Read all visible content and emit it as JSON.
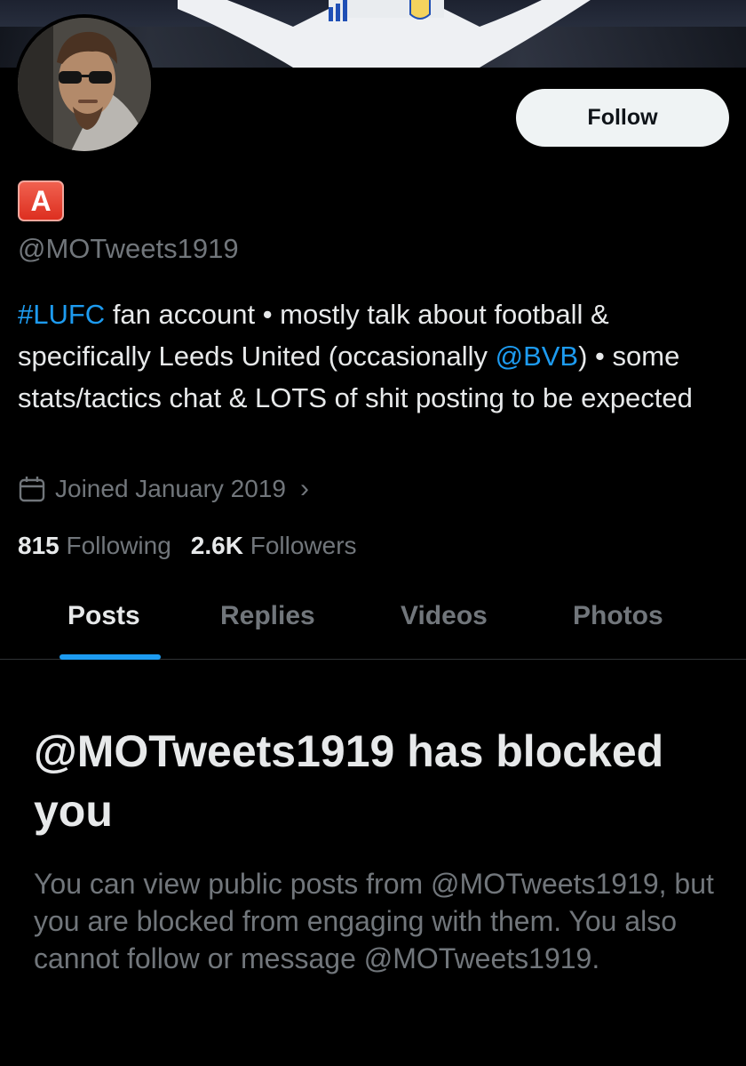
{
  "profile": {
    "handle": "@MOTweets1919",
    "badge_letter": "A",
    "follow_label": "Follow",
    "bio": {
      "hashtag": "#LUFC",
      "text1": " fan account • mostly talk about football & specifically Leeds United (occasionally ",
      "mention": "@BVB",
      "text2": ") • some stats/tactics chat & LOTS of shit posting to be expected"
    },
    "joined": "Joined January 2019",
    "following_count": "815",
    "following_label": "Following",
    "followers_count": "2.6K",
    "followers_label": "Followers"
  },
  "tabs": [
    {
      "label": "Posts",
      "active": true
    },
    {
      "label": "Replies",
      "active": false
    },
    {
      "label": "Videos",
      "active": false
    },
    {
      "label": "Photos",
      "active": false
    }
  ],
  "blocked": {
    "title": "@MOTweets1919 has blocked you",
    "description": "You can view public posts from @MOTweets1919, but you are blocked from engaging with them. You also cannot follow or message @MOTweets1919."
  },
  "colors": {
    "background": "#000000",
    "accent": "#1d9bf0",
    "muted": "#71767b",
    "text": "#e7e9ea"
  }
}
